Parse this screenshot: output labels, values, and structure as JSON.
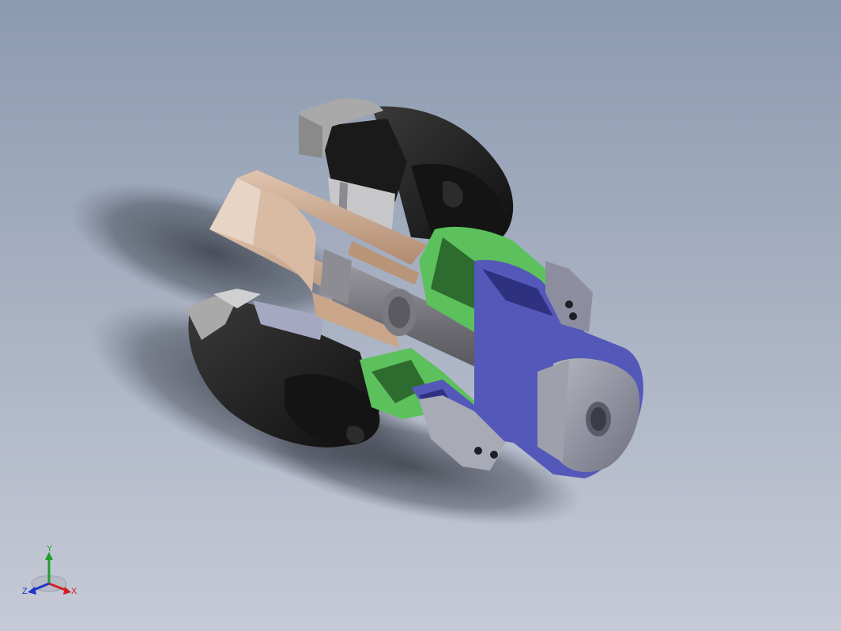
{
  "viewport": {
    "background_top": "#8C9AB0",
    "background_bottom": "#C6CAD6"
  },
  "model": {
    "part_colors": {
      "housing": "#1E1E1E",
      "housing_cap": "#A9A9A9",
      "sleeve": "#C9A58A",
      "shaft": "#6E6E73",
      "hub": "#5CC15C",
      "hub_dark": "#2E6B2E",
      "collet": "#5458B8",
      "collet_dark": "#2E3180",
      "end_face": "#8E909C"
    }
  },
  "triad": {
    "x_label": "X",
    "y_label": "Y",
    "z_label": "Z",
    "x_color": "#D42020",
    "y_color": "#1F9E2A",
    "z_color": "#1E35C8"
  }
}
